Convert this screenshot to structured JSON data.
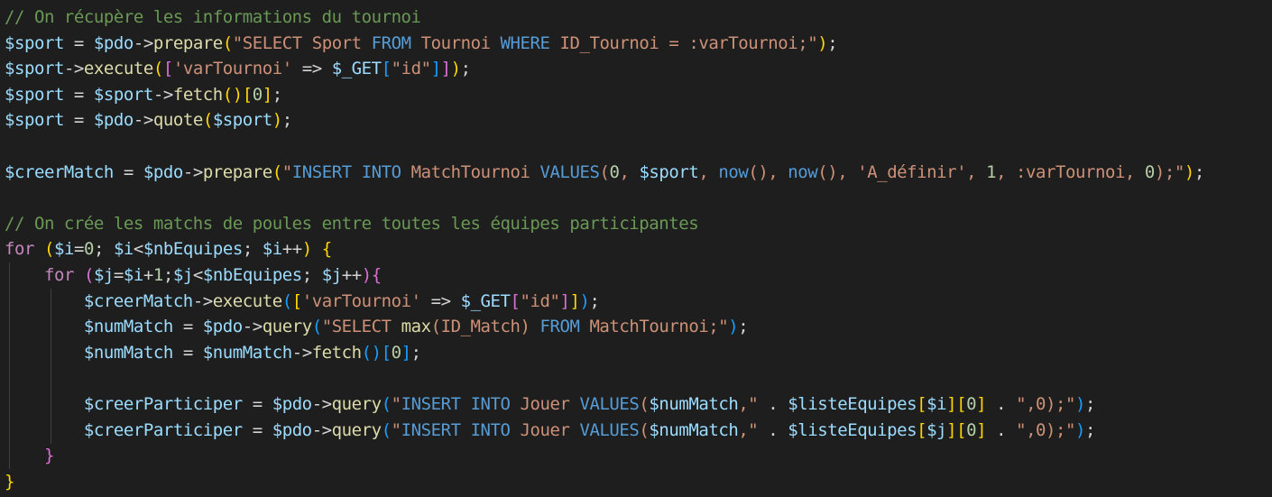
{
  "editor": {
    "theme": {
      "background": "#1e1e1e",
      "comment": "#6a9955",
      "variable": "#9cdcfe",
      "function": "#dcdcaa",
      "keyword": "#c586c0",
      "sqlKeyword": "#569cd6",
      "string": "#ce9178",
      "number": "#b5cea8",
      "operator": "#d4d4d4",
      "bracket1": "#ffd700",
      "bracket2": "#da70d6",
      "bracket3": "#179fff",
      "indentGuide": "#404040"
    },
    "lines": [
      [
        [
          "c",
          "// On récupère les informations du tournoi"
        ]
      ],
      [
        [
          "v",
          "$sport"
        ],
        [
          "o",
          " = "
        ],
        [
          "v",
          "$pdo"
        ],
        [
          "o",
          "->"
        ],
        [
          "f",
          "prepare"
        ],
        [
          "b1",
          "("
        ],
        [
          "s",
          "\"SELECT "
        ],
        [
          "s",
          "Sport"
        ],
        [
          "s",
          " "
        ],
        [
          "k",
          "FROM"
        ],
        [
          "s",
          " Tournoi "
        ],
        [
          "k",
          "WHERE"
        ],
        [
          "s",
          " ID_Tournoi = :varTournoi;\""
        ],
        [
          "b1",
          ")"
        ],
        [
          "o",
          ";"
        ]
      ],
      [
        [
          "v",
          "$sport"
        ],
        [
          "o",
          "->"
        ],
        [
          "f",
          "execute"
        ],
        [
          "b1",
          "("
        ],
        [
          "b2",
          "["
        ],
        [
          "s",
          "'varTournoi'"
        ],
        [
          "o",
          " => "
        ],
        [
          "v",
          "$_GET"
        ],
        [
          "b3",
          "["
        ],
        [
          "s",
          "\"id\""
        ],
        [
          "b3",
          "]"
        ],
        [
          "b2",
          "]"
        ],
        [
          "b1",
          ")"
        ],
        [
          "o",
          ";"
        ]
      ],
      [
        [
          "v",
          "$sport"
        ],
        [
          "o",
          " = "
        ],
        [
          "v",
          "$sport"
        ],
        [
          "o",
          "->"
        ],
        [
          "f",
          "fetch"
        ],
        [
          "b1",
          "()"
        ],
        [
          "b1",
          "["
        ],
        [
          "n",
          "0"
        ],
        [
          "b1",
          "]"
        ],
        [
          "o",
          ";"
        ]
      ],
      [
        [
          "v",
          "$sport"
        ],
        [
          "o",
          " = "
        ],
        [
          "v",
          "$pdo"
        ],
        [
          "o",
          "->"
        ],
        [
          "f",
          "quote"
        ],
        [
          "b1",
          "("
        ],
        [
          "v",
          "$sport"
        ],
        [
          "b1",
          ")"
        ],
        [
          "o",
          ";"
        ]
      ],
      [],
      [
        [
          "v",
          "$creerMatch"
        ],
        [
          "o",
          " = "
        ],
        [
          "v",
          "$pdo"
        ],
        [
          "o",
          "->"
        ],
        [
          "f",
          "prepare"
        ],
        [
          "b1",
          "("
        ],
        [
          "s",
          "\""
        ],
        [
          "k",
          "INSERT"
        ],
        [
          "s",
          " "
        ],
        [
          "k",
          "INTO"
        ],
        [
          "s",
          " MatchTournoi "
        ],
        [
          "k",
          "VALUES"
        ],
        [
          "s",
          "("
        ],
        [
          "n",
          "0"
        ],
        [
          "s",
          ", "
        ],
        [
          "v",
          "$sport"
        ],
        [
          "s",
          ", "
        ],
        [
          "k",
          "now"
        ],
        [
          "s",
          "(), "
        ],
        [
          "k",
          "now"
        ],
        [
          "s",
          "(), 'A_définir', "
        ],
        [
          "n",
          "1"
        ],
        [
          "s",
          ", :varTournoi, "
        ],
        [
          "n",
          "0"
        ],
        [
          "s",
          ");\""
        ],
        [
          "b1",
          ")"
        ],
        [
          "o",
          ";"
        ]
      ],
      [],
      [
        [
          "c",
          "// On crée les matchs de poules entre toutes les équipes participantes"
        ]
      ],
      [
        [
          "kw",
          "for"
        ],
        [
          "o",
          " "
        ],
        [
          "b1",
          "("
        ],
        [
          "v",
          "$i"
        ],
        [
          "o",
          "="
        ],
        [
          "n",
          "0"
        ],
        [
          "o",
          "; "
        ],
        [
          "v",
          "$i"
        ],
        [
          "o",
          "<"
        ],
        [
          "v",
          "$nbEquipes"
        ],
        [
          "o",
          "; "
        ],
        [
          "v",
          "$i"
        ],
        [
          "o",
          "++"
        ],
        [
          "b1",
          ")"
        ],
        [
          "o",
          " "
        ],
        [
          "b1",
          "{"
        ]
      ],
      [
        [
          "o",
          "    "
        ],
        [
          "kw",
          "for"
        ],
        [
          "o",
          " "
        ],
        [
          "b2",
          "("
        ],
        [
          "v",
          "$j"
        ],
        [
          "o",
          "="
        ],
        [
          "v",
          "$i"
        ],
        [
          "o",
          "+"
        ],
        [
          "n",
          "1"
        ],
        [
          "o",
          ";"
        ],
        [
          "v",
          "$j"
        ],
        [
          "o",
          "<"
        ],
        [
          "v",
          "$nbEquipes"
        ],
        [
          "o",
          "; "
        ],
        [
          "v",
          "$j"
        ],
        [
          "o",
          "++"
        ],
        [
          "b2",
          ")"
        ],
        [
          "b2",
          "{"
        ]
      ],
      [
        [
          "o",
          "        "
        ],
        [
          "v",
          "$creerMatch"
        ],
        [
          "o",
          "->"
        ],
        [
          "f",
          "execute"
        ],
        [
          "b3",
          "("
        ],
        [
          "b1",
          "["
        ],
        [
          "s",
          "'varTournoi'"
        ],
        [
          "o",
          " => "
        ],
        [
          "v",
          "$_GET"
        ],
        [
          "b2",
          "["
        ],
        [
          "s",
          "\"id\""
        ],
        [
          "b2",
          "]"
        ],
        [
          "b1",
          "]"
        ],
        [
          "b3",
          ")"
        ],
        [
          "o",
          ";"
        ]
      ],
      [
        [
          "o",
          "        "
        ],
        [
          "v",
          "$numMatch"
        ],
        [
          "o",
          " = "
        ],
        [
          "v",
          "$pdo"
        ],
        [
          "o",
          "->"
        ],
        [
          "f",
          "query"
        ],
        [
          "b3",
          "("
        ],
        [
          "s",
          "\"SELECT "
        ],
        [
          "f",
          "max"
        ],
        [
          "s",
          "(ID_Match) "
        ],
        [
          "k",
          "FROM"
        ],
        [
          "s",
          " MatchTournoi;\""
        ],
        [
          "b3",
          ")"
        ],
        [
          "o",
          ";"
        ]
      ],
      [
        [
          "o",
          "        "
        ],
        [
          "v",
          "$numMatch"
        ],
        [
          "o",
          " = "
        ],
        [
          "v",
          "$numMatch"
        ],
        [
          "o",
          "->"
        ],
        [
          "f",
          "fetch"
        ],
        [
          "b3",
          "()"
        ],
        [
          "b3",
          "["
        ],
        [
          "n",
          "0"
        ],
        [
          "b3",
          "]"
        ],
        [
          "o",
          ";"
        ]
      ],
      [],
      [
        [
          "o",
          "        "
        ],
        [
          "v",
          "$creerParticiper"
        ],
        [
          "o",
          " = "
        ],
        [
          "v",
          "$pdo"
        ],
        [
          "o",
          "->"
        ],
        [
          "f",
          "query"
        ],
        [
          "b3",
          "("
        ],
        [
          "s",
          "\""
        ],
        [
          "k",
          "INSERT"
        ],
        [
          "s",
          " "
        ],
        [
          "k",
          "INTO"
        ],
        [
          "s",
          " Jouer "
        ],
        [
          "k",
          "VALUES"
        ],
        [
          "s",
          "("
        ],
        [
          "v",
          "$numMatch"
        ],
        [
          "s",
          ",\""
        ],
        [
          "o",
          " . "
        ],
        [
          "v",
          "$listeEquipes"
        ],
        [
          "b1",
          "["
        ],
        [
          "v",
          "$i"
        ],
        [
          "b1",
          "]"
        ],
        [
          "b1",
          "["
        ],
        [
          "n",
          "0"
        ],
        [
          "b1",
          "]"
        ],
        [
          "o",
          " . "
        ],
        [
          "s",
          "\",0);\""
        ],
        [
          "b3",
          ")"
        ],
        [
          "o",
          ";"
        ]
      ],
      [
        [
          "o",
          "        "
        ],
        [
          "v",
          "$creerParticiper"
        ],
        [
          "o",
          " = "
        ],
        [
          "v",
          "$pdo"
        ],
        [
          "o",
          "->"
        ],
        [
          "f",
          "query"
        ],
        [
          "b3",
          "("
        ],
        [
          "s",
          "\""
        ],
        [
          "k",
          "INSERT"
        ],
        [
          "s",
          " "
        ],
        [
          "k",
          "INTO"
        ],
        [
          "s",
          " Jouer "
        ],
        [
          "k",
          "VALUES"
        ],
        [
          "s",
          "("
        ],
        [
          "v",
          "$numMatch"
        ],
        [
          "s",
          ",\""
        ],
        [
          "o",
          " . "
        ],
        [
          "v",
          "$listeEquipes"
        ],
        [
          "b1",
          "["
        ],
        [
          "v",
          "$j"
        ],
        [
          "b1",
          "]"
        ],
        [
          "b1",
          "["
        ],
        [
          "n",
          "0"
        ],
        [
          "b1",
          "]"
        ],
        [
          "o",
          " . "
        ],
        [
          "s",
          "\",0);\""
        ],
        [
          "b3",
          ")"
        ],
        [
          "o",
          ";"
        ]
      ],
      [
        [
          "o",
          "    "
        ],
        [
          "b2",
          "}"
        ]
      ],
      [
        [
          "b1",
          "}"
        ]
      ]
    ]
  }
}
